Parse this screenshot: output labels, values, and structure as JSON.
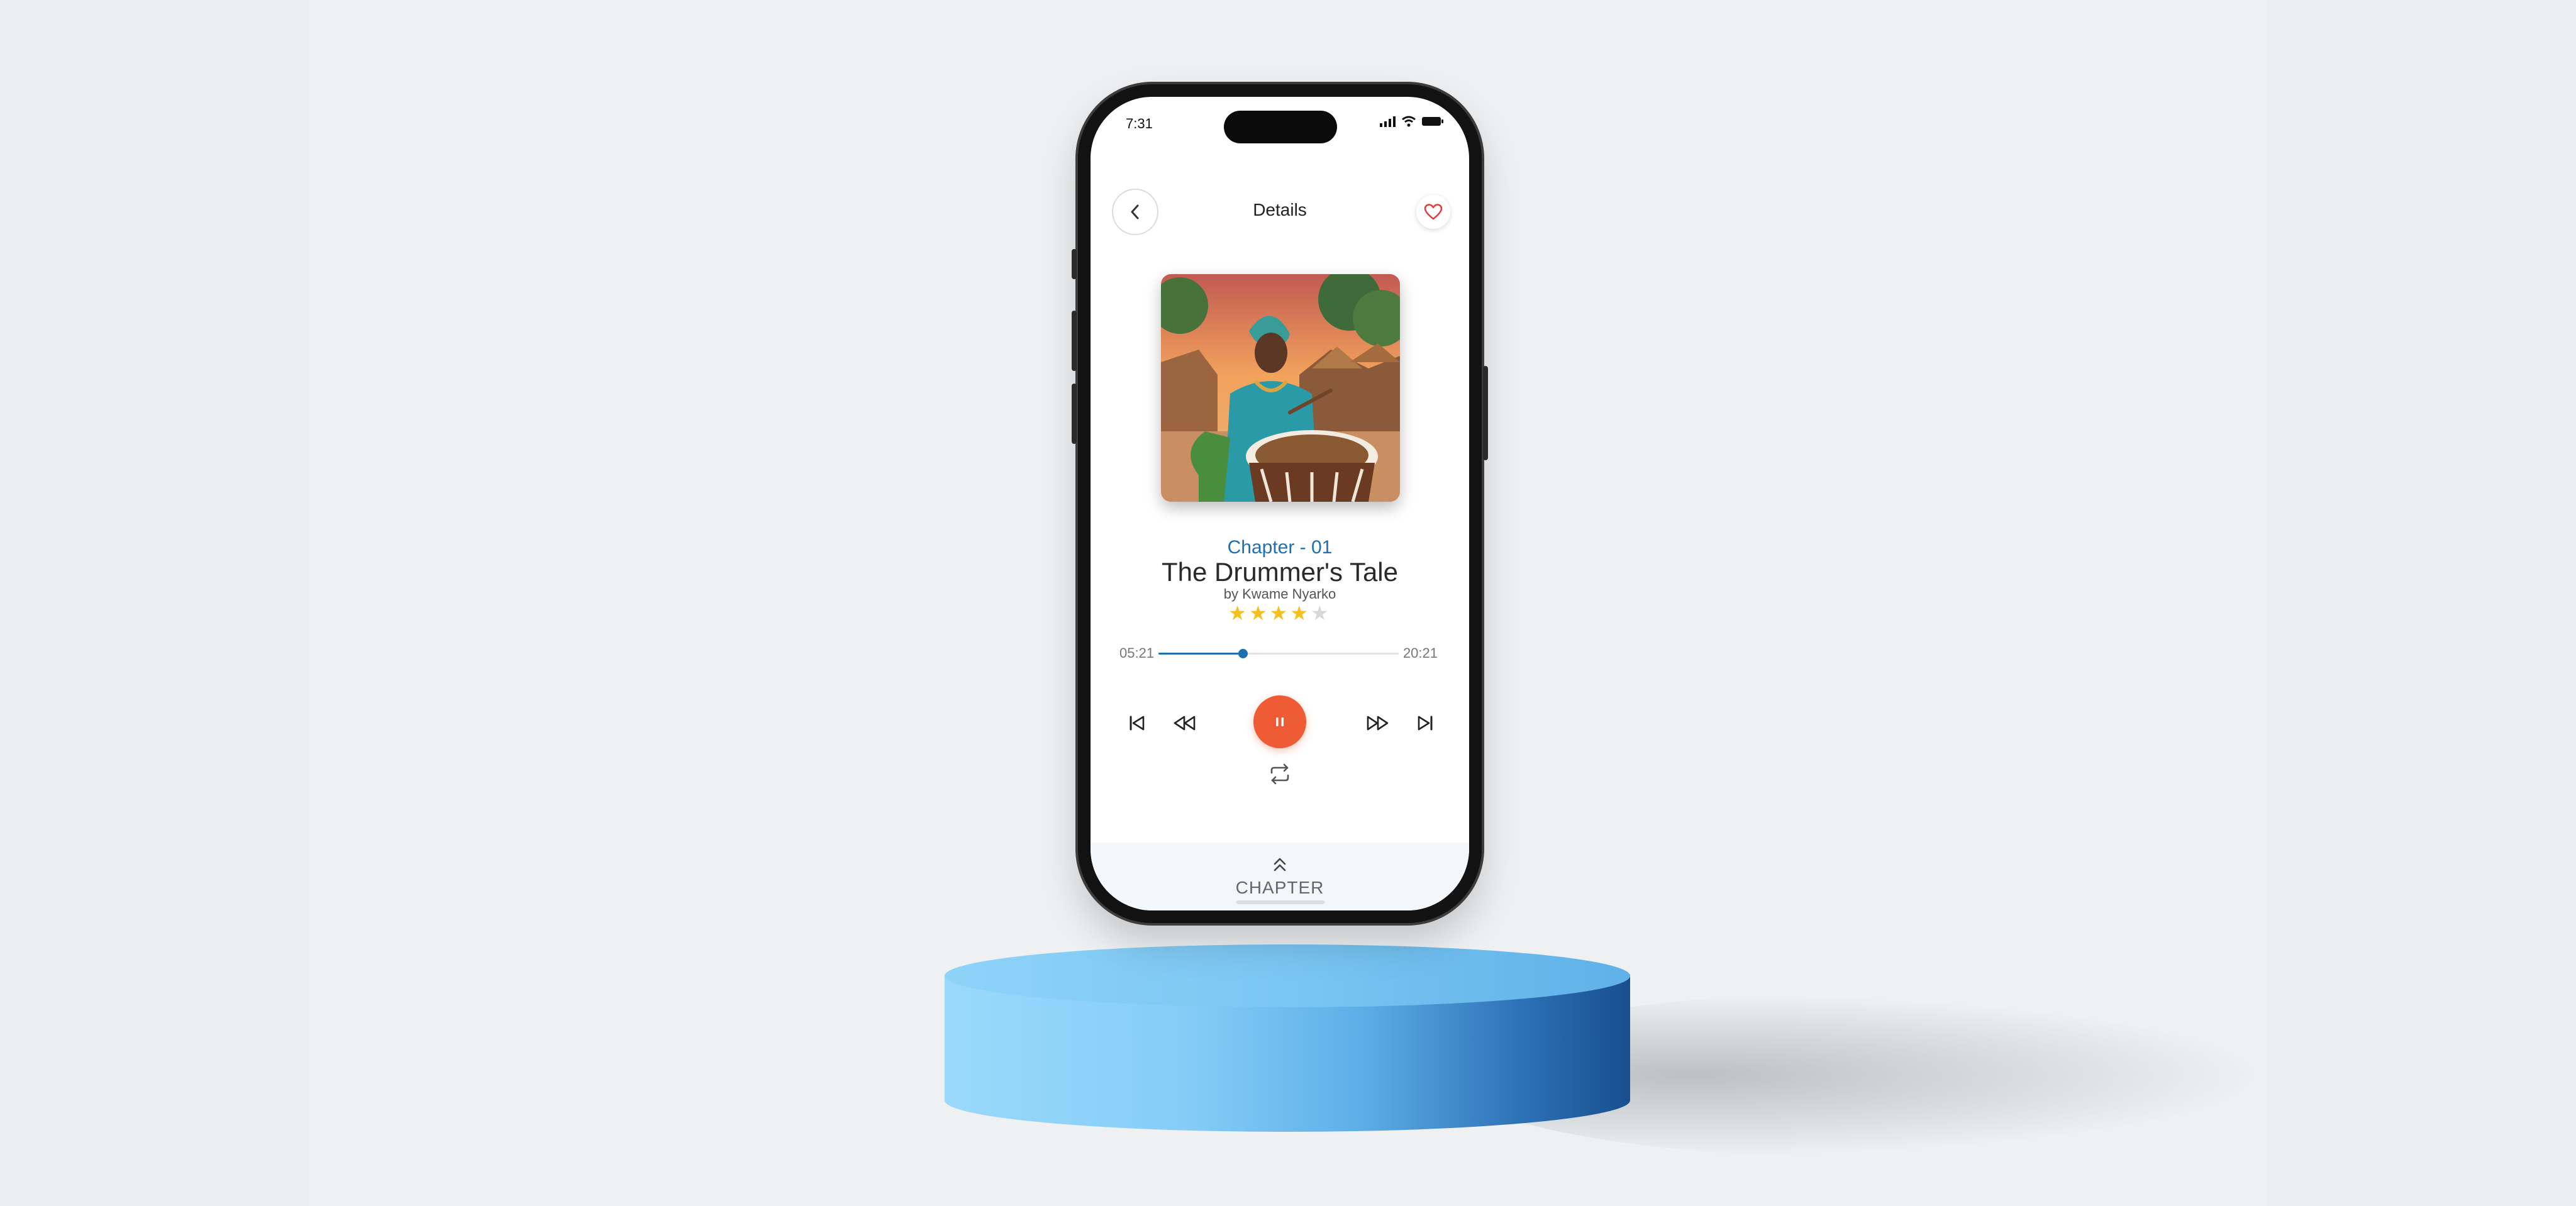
{
  "status": {
    "time": "7:31"
  },
  "header": {
    "title": "Details"
  },
  "book": {
    "chapter": "Chapter - 01",
    "title": "The Drummer's Tale",
    "author": "by Kwame Nyarko",
    "rating": 4,
    "rating_max": 5
  },
  "player": {
    "current_time": "05:21",
    "total_time": "20:21",
    "progress": 0.35,
    "state": "playing"
  },
  "bottom_sheet": {
    "label": "CHAPTER"
  },
  "colors": {
    "accent": "#1f6fb0",
    "play_button": "#ef5b34",
    "star": "#f4c121",
    "favorite": "#e53935",
    "podium": "#7ac6f3"
  },
  "icons": [
    "back-chevron-icon",
    "heart-icon",
    "skip-previous-icon",
    "rewind-icon",
    "pause-icon",
    "fast-forward-icon",
    "skip-next-icon",
    "repeat-icon",
    "chevron-up-double-icon",
    "signal-icon",
    "wifi-icon",
    "battery-icon"
  ]
}
